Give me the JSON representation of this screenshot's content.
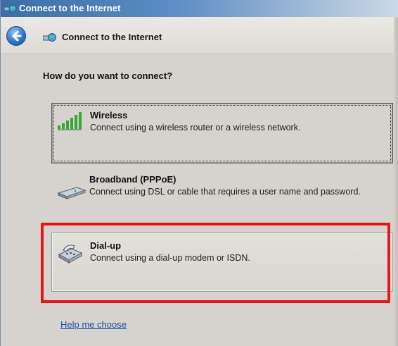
{
  "window": {
    "title": "Connect to the Internet"
  },
  "nav": {
    "back_icon": "back-arrow-icon",
    "title": "Connect to the Internet"
  },
  "main": {
    "question": "How do you want to connect?",
    "options": [
      {
        "title": "Wireless",
        "description": "Connect using a wireless router or a wireless network.",
        "icon": "wireless-signal-icon",
        "state": "focused"
      },
      {
        "title": "Broadband (PPPoE)",
        "description": "Connect using DSL or cable that requires a user name and password.",
        "icon": "broadband-modem-icon",
        "state": "normal"
      },
      {
        "title": "Dial-up",
        "description": "Connect using a dial-up modem or ISDN.",
        "icon": "dialup-modem-icon",
        "state": "hovered"
      }
    ],
    "help_link": "Help me choose"
  },
  "annotation": {
    "highlight_color": "#e8141a"
  }
}
